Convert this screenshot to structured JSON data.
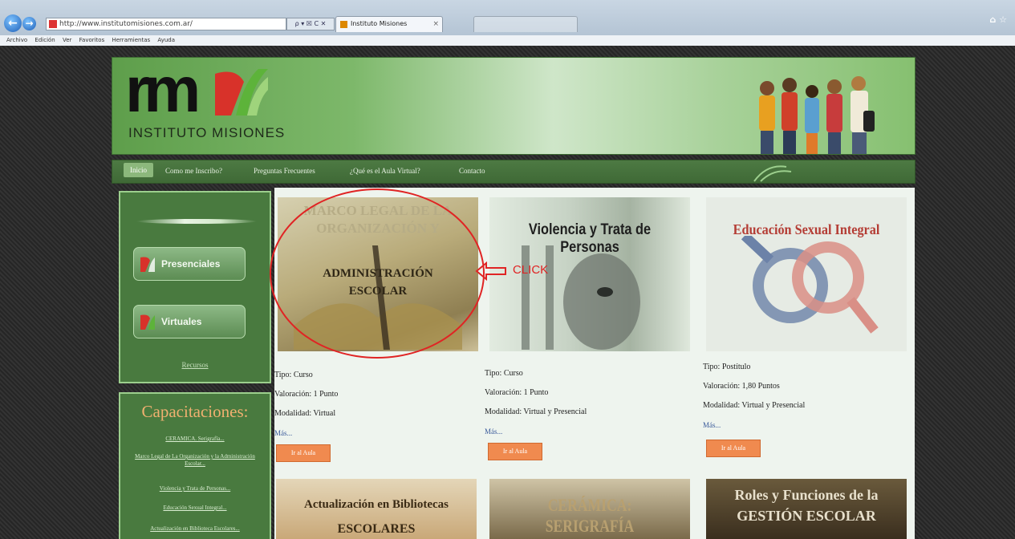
{
  "browser": {
    "address": "http://www.institutomisiones.com.ar/",
    "address_tools": "ρ ▾ ☒ C ✕",
    "active_tab": "Instituto Misiones",
    "tab_close": "×",
    "window_controls": "⌂ ☆",
    "menu": [
      "Archivo",
      "Edición",
      "Ver",
      "Favoritos",
      "Herramientas",
      "Ayuda"
    ]
  },
  "header": {
    "logo_letters": "rm",
    "logo_text": "INSTITUTO MISIONES"
  },
  "nav": {
    "items": [
      "Inicio",
      "Como me Inscribo?",
      "Preguntas Frecuentes",
      "¿Qué es el Aula Virtual?",
      "Contacto"
    ]
  },
  "sidebar": {
    "btn_presenciales": "Presenciales",
    "btn_virtuales": "Virtuales",
    "link": "Recursos",
    "cap_title": "Capacitaciones:",
    "cap_links": [
      "CERAMICA. Serigrafía...",
      "Marco Legal de La Organización y la Administración Escolar...",
      "Violencia y Trata de Personas...",
      "Educación Sexual Integral...",
      "Actualización en Biblioteca Escolares..."
    ]
  },
  "courses": [
    {
      "thumb_title_1": "MARCO LEGAL DE LA ORGANIZACIÓN Y",
      "thumb_title_2": "ADMINISTRACIÓN ESCOLAR",
      "tipo": "Tipo: Curso",
      "valoracion": "Valoración: 1 Punto",
      "modalidad": "Modalidad: Virtual",
      "more": "Más...",
      "button": "Ir al Aula"
    },
    {
      "thumb_title": "Violencia y Trata de Personas",
      "tipo": "Tipo: Curso",
      "valoracion": "Valoración: 1 Punto",
      "modalidad": "Modalidad: Virtual y Presencial",
      "more": "Más...",
      "button": "Ir al Aula"
    },
    {
      "thumb_title": "Educación Sexual Integral",
      "tipo": "Tipo: Postítulo",
      "valoracion": "Valoración: 1,80 Puntos",
      "modalidad": "Modalidad: Virtual y Presencial",
      "more": "Más...",
      "button": "Ir al Aula"
    }
  ],
  "courses_row2": [
    {
      "thumb_title_1": "Actualización en Bibliotecas",
      "thumb_title_2": "ESCOLARES"
    },
    {
      "thumb_title": "CERÁMICA: SERIGRAFÍA"
    },
    {
      "thumb_title_1": "Roles y Funciones de la",
      "thumb_title_2": "GESTIÓN ESCOLAR"
    }
  ],
  "annotation": {
    "text": "CLICK",
    "color": "#e02424"
  }
}
